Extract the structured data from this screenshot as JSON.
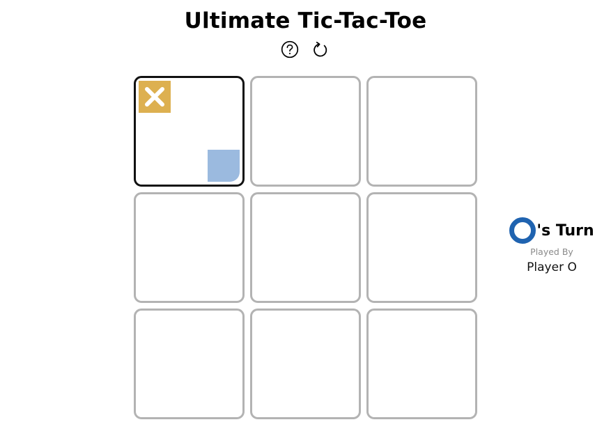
{
  "title": "Ultimate Tic-Tac-Toe",
  "controls": [
    {
      "name": "help-button",
      "icon": "question-circle-icon"
    },
    {
      "name": "restart-button",
      "icon": "restart-icon"
    }
  ],
  "colors": {
    "x": "#ddb050",
    "o": "#1f63b0",
    "o_hover": "#9bbadf",
    "active_border": "#111111",
    "inactive_border": "#b3b3b3"
  },
  "board": {
    "active_sub_board": 0,
    "sub_boards": [
      {
        "index": 0,
        "marks": [
          {
            "cell": 0,
            "symbol": "X"
          }
        ],
        "hover": {
          "cell": 8,
          "symbol": "O"
        }
      },
      {
        "index": 1,
        "marks": []
      },
      {
        "index": 2,
        "marks": []
      },
      {
        "index": 3,
        "marks": []
      },
      {
        "index": 4,
        "marks": []
      },
      {
        "index": 5,
        "marks": []
      },
      {
        "index": 6,
        "marks": []
      },
      {
        "index": 7,
        "marks": []
      },
      {
        "index": 8,
        "marks": []
      }
    ]
  },
  "turn": {
    "symbol": "O",
    "suffix": "'s Turn",
    "played_by_label": "Played By",
    "player_name": "Player O"
  }
}
